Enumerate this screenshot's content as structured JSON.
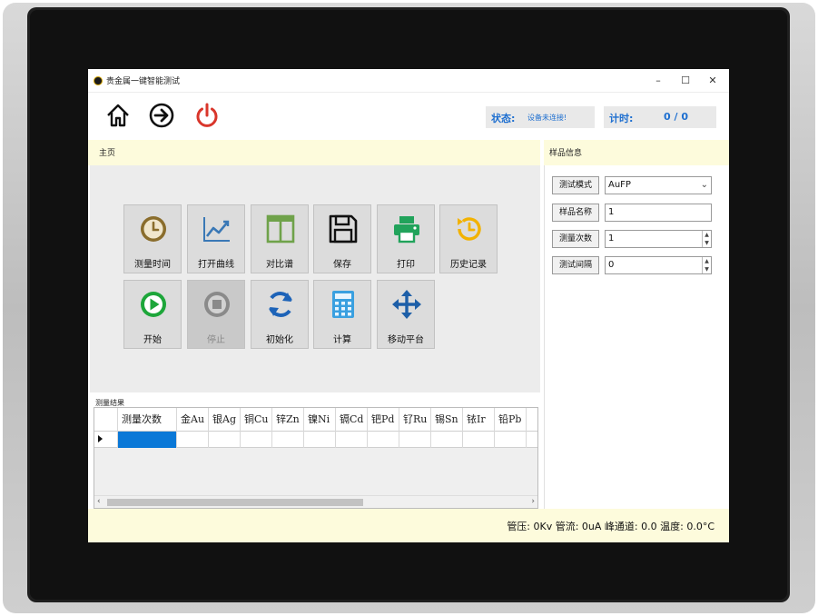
{
  "window": {
    "title": "贵金属一键智能测试",
    "minimize": "–",
    "maximize": "☐",
    "close": "✕"
  },
  "toolbar": {
    "icons": [
      "home-icon",
      "arrow-right-circle-icon",
      "power-icon"
    ],
    "status_label": "状态:",
    "status_value": "设备未连接!",
    "count_label": "计时:",
    "count_value": "0 / 0"
  },
  "panels": {
    "home_title": "主页",
    "sample_title": "样品信息",
    "results_title": "测量结果"
  },
  "functions": [
    {
      "label": "测量时间",
      "icon": "clock-icon",
      "color": "#8a6d2c",
      "enabled": true
    },
    {
      "label": "打开曲线",
      "icon": "line-chart-icon",
      "color": "#3a78b6",
      "enabled": true
    },
    {
      "label": "对比谱",
      "icon": "split-panel-icon",
      "color": "#6fa24a",
      "enabled": true
    },
    {
      "label": "保存",
      "icon": "floppy-disk-icon",
      "color": "#111111",
      "enabled": true
    },
    {
      "label": "打印",
      "icon": "printer-icon",
      "color": "#21a35b",
      "enabled": true
    },
    {
      "label": "历史记录",
      "icon": "history-icon",
      "color": "#f2b200",
      "enabled": true
    },
    {
      "label": "开始",
      "icon": "play-icon",
      "color": "#1da63a",
      "enabled": true
    },
    {
      "label": "停止",
      "icon": "stop-icon",
      "color": "#8a8a8a",
      "enabled": false
    },
    {
      "label": "初始化",
      "icon": "refresh-icon",
      "color": "#1d63b8",
      "enabled": true
    },
    {
      "label": "计算",
      "icon": "calculator-icon",
      "color": "#3aa0e0",
      "enabled": true
    },
    {
      "label": "移动平台",
      "icon": "move-icon",
      "color": "#1d5fa8",
      "enabled": true
    }
  ],
  "sample": {
    "mode_label": "测试模式",
    "mode_value": "AuFP",
    "name_label": "样品名称",
    "name_value": "1",
    "count_label": "测量次数",
    "count_value": "1",
    "interval_label": "测试间隔",
    "interval_value": "0"
  },
  "results": {
    "columns": [
      "测量次数",
      "金Au",
      "银Ag",
      "铜Cu",
      "锌Zn",
      "镍Ni",
      "镉Cd",
      "钯Pd",
      "钌Ru",
      "锡Sn",
      "铱Ir",
      "铅Pb"
    ],
    "rows": [
      [
        "",
        "",
        "",
        "",
        "",
        "",
        "",
        "",
        "",
        "",
        "",
        ""
      ]
    ]
  },
  "statusbar": {
    "text": "管压: 0Kv 管流: 0uA 峰通道: 0.0 温度: 0.0°C"
  }
}
